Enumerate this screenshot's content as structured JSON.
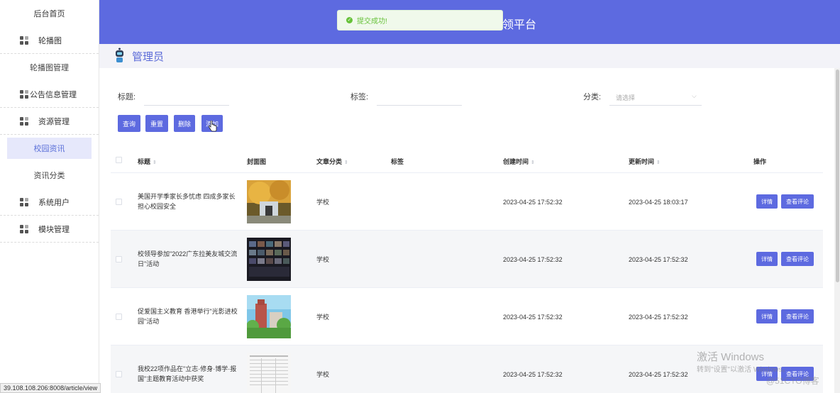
{
  "sidebar": {
    "home": "后台首页",
    "items": [
      {
        "label": "轮播图",
        "icon": "grid-icon"
      },
      {
        "label": "轮播图管理",
        "sub": true
      },
      {
        "label": "公告信息管理",
        "icon": "grid-icon"
      },
      {
        "label": "资源管理",
        "icon": "grid-icon"
      },
      {
        "label": "校园资讯",
        "sub": true,
        "active": true
      },
      {
        "label": "资讯分类",
        "sub": true
      },
      {
        "label": "系统用户",
        "icon": "grid-icon"
      },
      {
        "label": "模块管理",
        "icon": "grid-icon"
      }
    ]
  },
  "header": {
    "title_partial": "领平台",
    "toast": "提交成功!",
    "bg_color": "#5d6ae0"
  },
  "page": {
    "title": "管理员"
  },
  "filters": {
    "title_label": "标题:",
    "tag_label": "标签:",
    "category_label": "分类:",
    "category_placeholder": "请选择"
  },
  "buttons": {
    "query": "查询",
    "reset": "重置",
    "delete": "删除",
    "add": "添加"
  },
  "table": {
    "headers": {
      "title": "标题",
      "cover": "封面图",
      "category": "文章分类",
      "tags": "标签",
      "created": "创建时间",
      "updated": "更新时间",
      "actions": "操作"
    },
    "rows": [
      {
        "title": "美国开学季家长多忧虑 四成多家长担心校园安全",
        "category": "学校",
        "created": "2023-04-25 17:52:32",
        "updated": "2023-04-25 18:03:17"
      },
      {
        "title": "校领导参加\"2022广东拉美友城交流日\"活动",
        "category": "学校",
        "created": "2023-04-25 17:52:32",
        "updated": "2023-04-25 17:52:32"
      },
      {
        "title": "促爱国主义教育 香港举行\"光影进校园\"活动",
        "category": "学校",
        "created": "2023-04-25 17:52:32",
        "updated": "2023-04-25 17:52:32"
      },
      {
        "title": "我校22项作品在\"立志·修身·博学·报国\"主题教育活动中获奖",
        "category": "学校",
        "created": "2023-04-25 17:52:32",
        "updated": "2023-04-25 17:52:32"
      }
    ],
    "detail_label": "详情",
    "comments_label": "查看评论"
  },
  "status_url": "39.108.108.206:8008/article/view",
  "watermark": {
    "activate_title": "激活 Windows",
    "activate_sub": "转到\"设置\"以激活 Windows。",
    "blog": "@51CTO博客"
  }
}
